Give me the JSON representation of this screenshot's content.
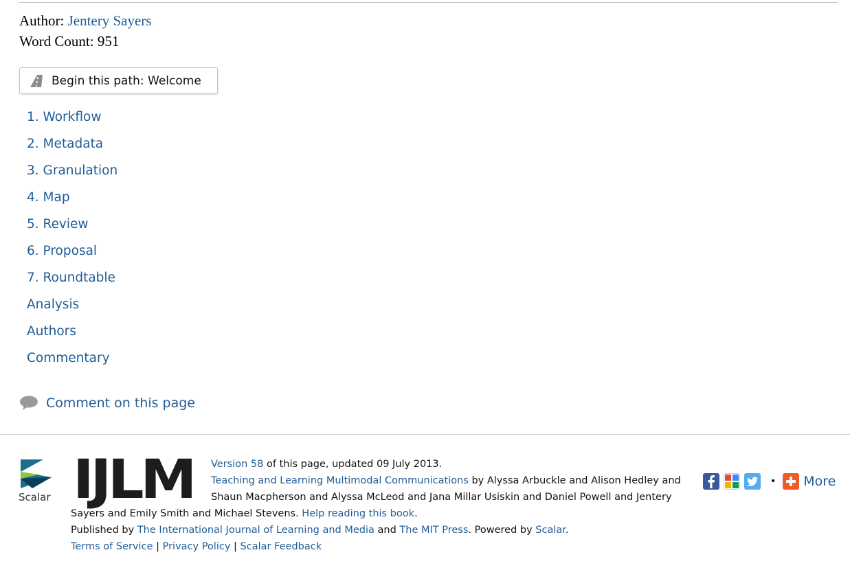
{
  "meta": {
    "author_label": "Author:",
    "author_name": "Jentery Sayers",
    "word_count_label": "Word Count:",
    "word_count_value": "951"
  },
  "begin_path": {
    "label": "Begin this path: Welcome",
    "icon": "road-icon"
  },
  "path_items": [
    {
      "label": "1. Workflow"
    },
    {
      "label": "2. Metadata"
    },
    {
      "label": "3. Granulation"
    },
    {
      "label": "4. Map"
    },
    {
      "label": "5. Review"
    },
    {
      "label": "6. Proposal"
    },
    {
      "label": "7. Roundtable"
    },
    {
      "label": "Analysis"
    },
    {
      "label": "Authors"
    },
    {
      "label": "Commentary"
    }
  ],
  "comment": {
    "label": "Comment on this page",
    "icon": "speech-bubble-icon"
  },
  "footer": {
    "scalar_logo_text": "Scalar",
    "ijlm_logo_text": "IJLM",
    "version_link": "Version 58",
    "version_rest": " of this page, updated 09 July 2013.",
    "book_title_link": "Teaching and Learning Multimodal Communications",
    "authors_part1": " by Alyssa Arbuckle and Alison Hedley and",
    "authors_part2": "Shaun Macpherson and Alyssa McLeod and Jana Millar Usiskin and Daniel Powell and Jentery",
    "authors_part3": "Sayers and Emily Smith and Michael Stevens. ",
    "help_link": "Help reading this book",
    "help_after": ".",
    "published_by": "Published by ",
    "publisher1": "The International Journal of Learning and Media",
    "and_text": " and ",
    "publisher2": "The MIT Press",
    "powered_by": ". Powered by ",
    "scalar_link": "Scalar",
    "powered_after": ".",
    "terms": "Terms of Service",
    "sep1": " | ",
    "privacy": "Privacy Policy",
    "sep2": " | ",
    "feedback": "Scalar Feedback"
  },
  "social": {
    "facebook_icon": "facebook-icon",
    "google_icon": "google-icon",
    "twitter_icon": "twitter-icon",
    "dot": "•",
    "more_label": "More",
    "colors": {
      "facebook": "#3b5998",
      "twitter": "#55acee",
      "more": "#f05a28"
    }
  },
  "colors": {
    "link": "#1f5c96"
  }
}
